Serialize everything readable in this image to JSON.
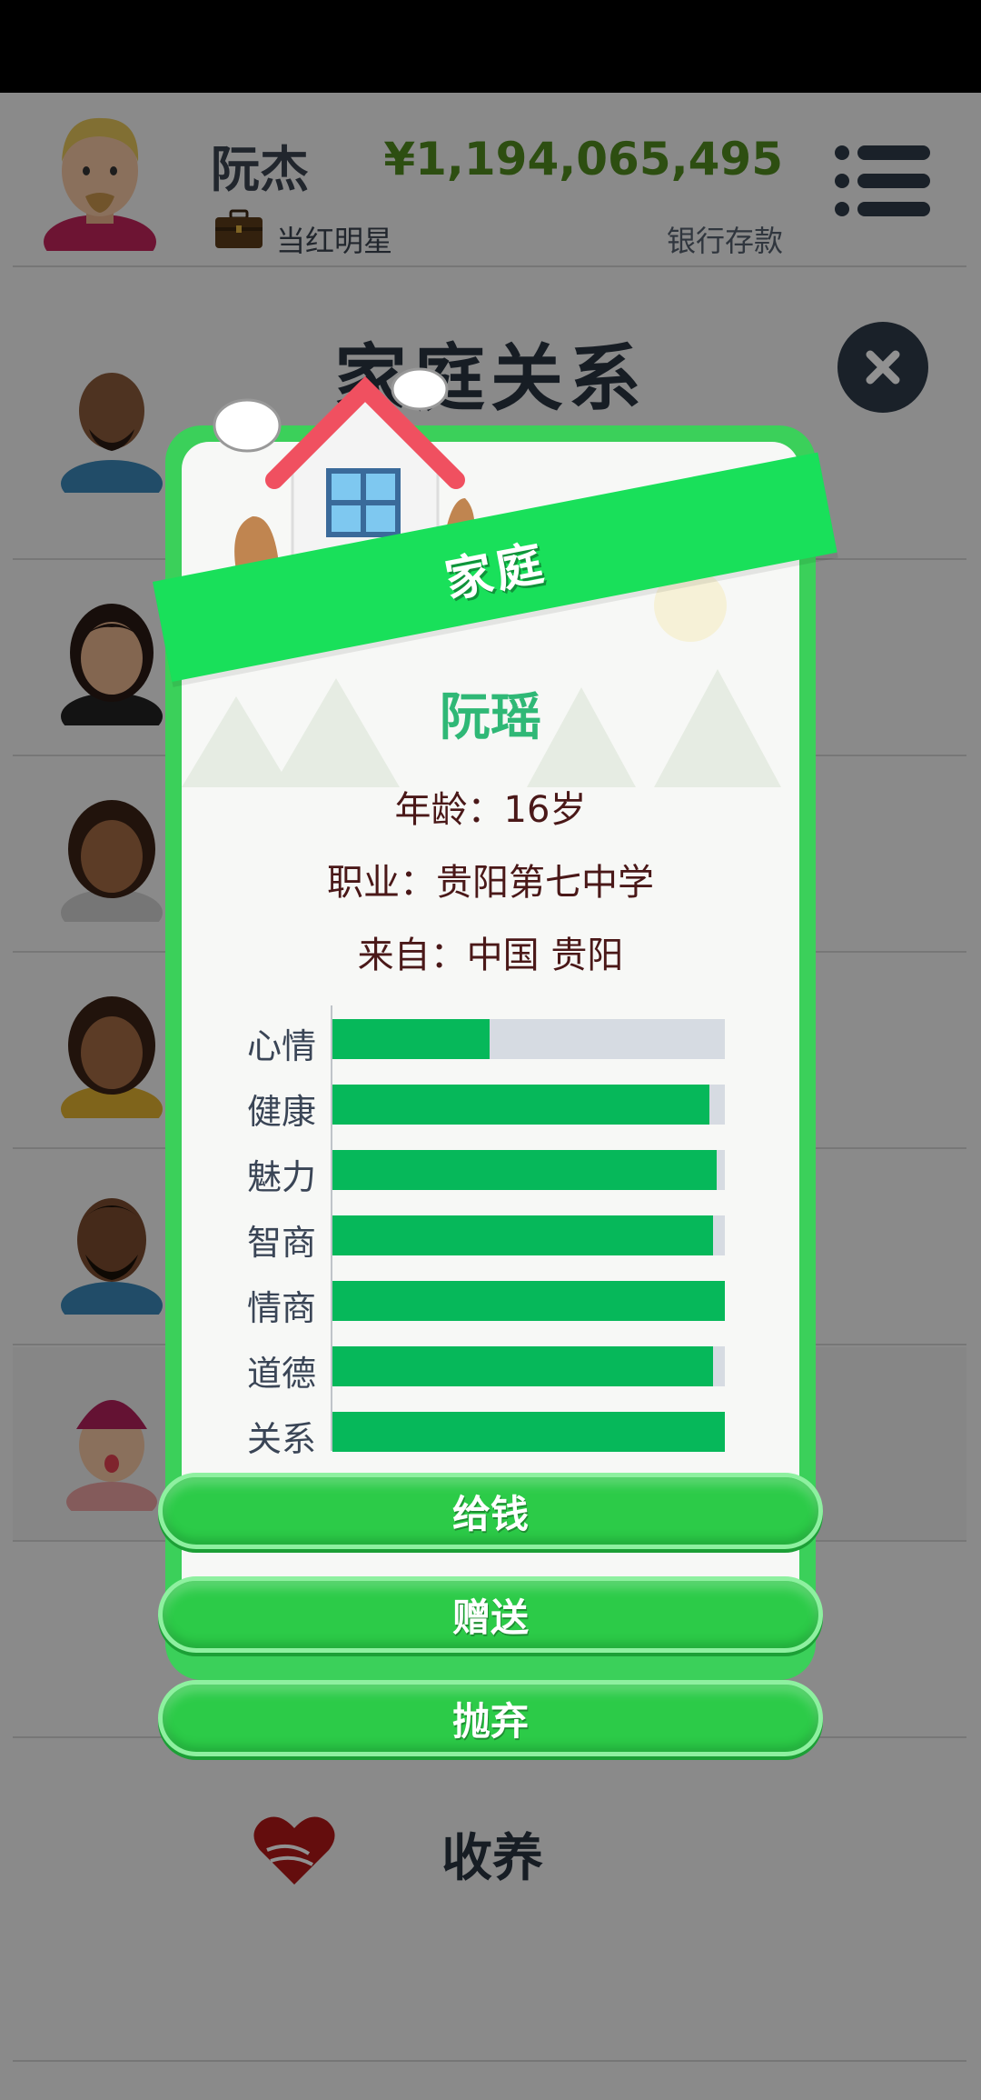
{
  "header": {
    "player_name": "阮杰",
    "job": "当红明星",
    "money": "¥1,194,065,495",
    "money_label": "银行存款"
  },
  "page": {
    "title": "家庭关系",
    "adopt_label": "收养"
  },
  "modal": {
    "ribbon_title": "家庭",
    "member_name": "阮瑶",
    "age": "年龄：16岁",
    "job": "职业：贵阳第七中学",
    "from": "来自：中国 贵阳",
    "stats": [
      {
        "label": "心情",
        "value": 0.4
      },
      {
        "label": "健康",
        "value": 0.96
      },
      {
        "label": "魅力",
        "value": 0.98
      },
      {
        "label": "智商",
        "value": 0.97
      },
      {
        "label": "情商",
        "value": 1.0
      },
      {
        "label": "道德",
        "value": 0.97
      },
      {
        "label": "关系",
        "value": 1.0
      }
    ],
    "buttons": {
      "give_money": "给钱",
      "gift": "赠送",
      "abandon": "抛弃"
    }
  },
  "colors": {
    "accent_green": "#19e05a",
    "bar_fill": "#06b85a",
    "money_green": "#4f8a1e"
  },
  "icons": [
    "avatar",
    "briefcase-icon",
    "menu-icon",
    "close-icon",
    "house-icon",
    "heart-hands-icon"
  ]
}
